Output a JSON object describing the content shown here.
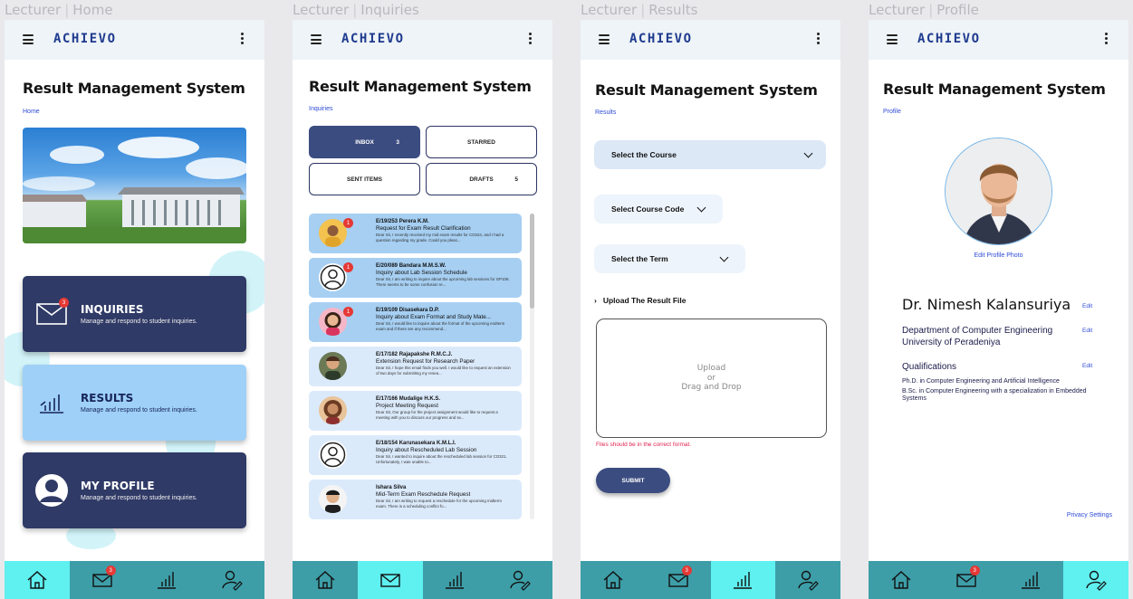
{
  "brand": "ACHIEVO",
  "app_title": "Result Management System",
  "frames": [
    {
      "role": "Lecturer",
      "screen": "Home"
    },
    {
      "role": "Lecturer",
      "screen": "Inquiries"
    },
    {
      "role": "Lecturer",
      "screen": "Results"
    },
    {
      "role": "Lecturer",
      "screen": "Profile"
    }
  ],
  "home": {
    "breadcrumb": "Home",
    "cards": [
      {
        "title": "INQUIRIES",
        "subtitle": "Manage and respond to student inquiries.",
        "icon": "mail-icon",
        "badge": "3"
      },
      {
        "title": "RESULTS",
        "subtitle": "Manage and respond to student inquiries.",
        "icon": "bar-chart-icon"
      },
      {
        "title": "MY PROFILE",
        "subtitle": "Manage and respond to student inquiries.",
        "icon": "user-circle-icon"
      }
    ]
  },
  "inquiries": {
    "breadcrumb": "Inquiries",
    "folders": [
      {
        "label": "INBOX",
        "count": "3"
      },
      {
        "label": "STARRED",
        "count": ""
      },
      {
        "label": "SENT ITEMS",
        "count": ""
      },
      {
        "label": "DRAFTS",
        "count": "5"
      }
    ],
    "messages": [
      {
        "sender": "E/19/253 Perera K.M.",
        "subject": "Request for Exam Result Clarification",
        "body": "Dear Sir, I recently received my mid exam results for CO224, and I had a question regarding my grade. Could you pleas...",
        "unread": true,
        "badge": "1",
        "avatar": "boy-yellow"
      },
      {
        "sender": "E/20/089 Bandara M.M.S.W.",
        "subject": "Inquiry about Lab Session Schedule",
        "body": "Dear Sir, I am writing to inquire about the upcoming lab sessions for GP106. There seems to be some confusion re...",
        "unread": true,
        "badge": "1",
        "avatar": "placeholder"
      },
      {
        "sender": "E/19/109 Disasekara D.P.",
        "subject": "Inquiry about Exam Format and Study Mate...",
        "body": "Dear Sir, I would like to inquire about the format of the upcoming endterm exam and if there are any recommend...",
        "unread": true,
        "badge": "1",
        "avatar": "girl-pink"
      },
      {
        "sender": "E/17/182 Rajapakshe R.M.C.J.",
        "subject": "Extension Request for Research Paper",
        "body": "Dear Sir, I hope this email finds you well. I would like to request an extension of two days for submitting my resea...",
        "unread": false,
        "badge": "",
        "avatar": "man"
      },
      {
        "sender": "E/17/166 Mudalige H.K.S.",
        "subject": "Project Meeting Request",
        "body": "Dear Sir, Our group for the project assignment would like to request a meeting with you to discuss our progress and se...",
        "unread": false,
        "badge": "",
        "avatar": "woman"
      },
      {
        "sender": "E/18/154 Karunasekara K.M.L.I.",
        "subject": "Inquiry about Rescheduled Lab Session",
        "body": "Dear Sir, I wanted to inquire about the rescheduled lab session for CO321. Unfortunately, I was unable to...",
        "unread": false,
        "badge": "",
        "avatar": "placeholder"
      },
      {
        "sender": "Ishara Silva",
        "subject": "Mid-Term Exam Reschedule Request",
        "body": "Dear Sir, I am writing to request a reschedule for the upcoming midterm exam. There is a scheduling conflict fo...",
        "unread": false,
        "badge": "",
        "avatar": "asian-man"
      }
    ]
  },
  "results": {
    "breadcrumb": "Results",
    "select_course": "Select the Course",
    "select_code": "Select Course Code",
    "select_term": "Select the Term",
    "upload_label": "Upload The Result File",
    "upload_line1": "Upload",
    "upload_line2": "or",
    "upload_line3": "Drag and Drop",
    "error": "Files should be in the correct format.",
    "submit": "SUBMIT"
  },
  "profile": {
    "breadcrumb": "Profile",
    "edit_photo": "Edit Profile Photo",
    "name": "Dr. Nimesh Kalansuriya",
    "dept_line1": "Department of Computer Engineering",
    "dept_line2": "University of Peradeniya",
    "qualifications_heading": "Qualifications",
    "qualifications": [
      "Ph.D. in Computer Engineering and Artificial Intelligence",
      "B.Sc. in Computer Engineering with a specialization in Embedded Systems"
    ],
    "edit": "Edit",
    "privacy": "Privacy Settings"
  },
  "nav": {
    "items": [
      "home-icon",
      "mail-icon",
      "bar-chart-icon",
      "user-edit-icon"
    ],
    "mail_badge": "3"
  },
  "colors": {
    "navbar": "#3d9ea8",
    "nav_active": "#5ff0f0",
    "dark_card": "#2f3a66",
    "light_card": "#9fd0f7",
    "link": "#2e4bd6",
    "error": "#e0204c",
    "badge": "#e53935"
  }
}
